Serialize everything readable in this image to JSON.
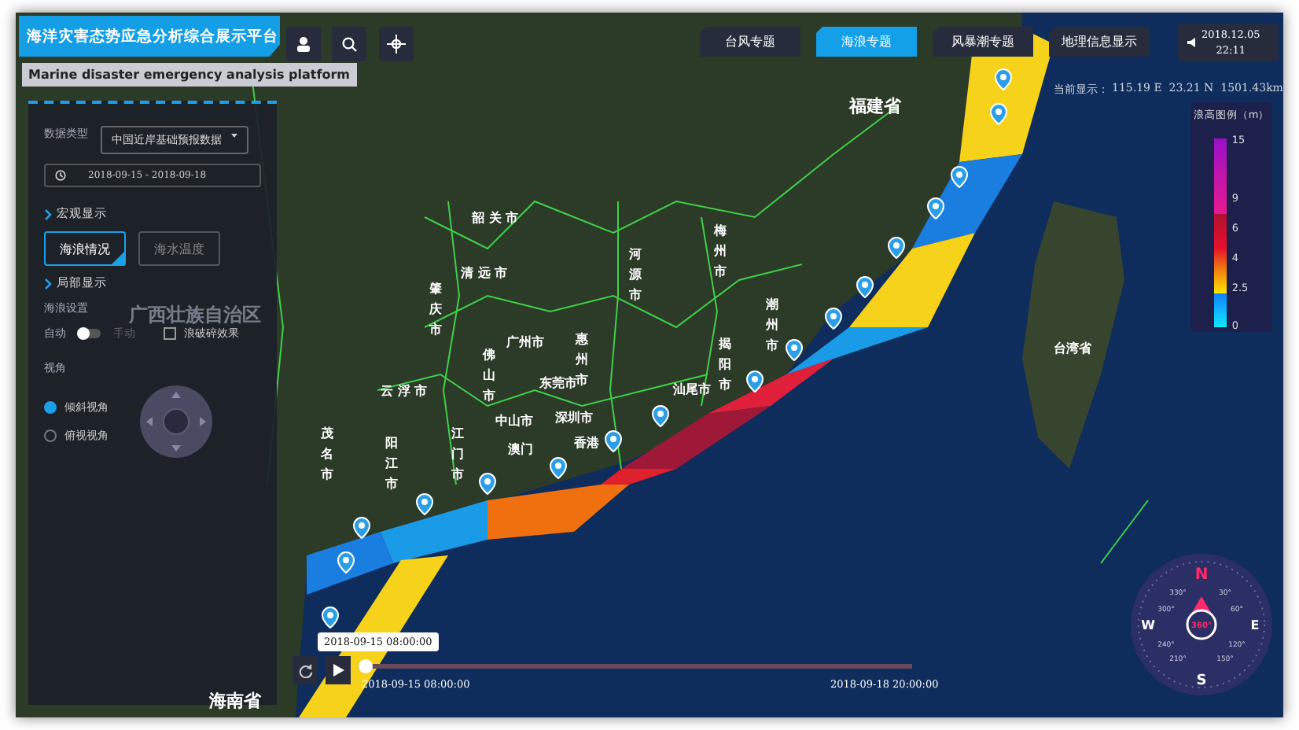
{
  "header": {
    "title": "海洋灾害态势应急分析综合展示平台",
    "subtitle": "Marine disaster emergency analysis platform"
  },
  "tabs": [
    {
      "label": "台风专题",
      "selected": false
    },
    {
      "label": "海浪专题",
      "selected": true
    },
    {
      "label": "风暴潮专题",
      "selected": false
    },
    {
      "label": "地理信息显示",
      "selected": false
    }
  ],
  "clock": {
    "date": "2018.12.05",
    "time": "22:11"
  },
  "coordinates": {
    "label": "当前显示：",
    "value": "115.19 E  23.21 N  1501.43km"
  },
  "panel": {
    "data_type_label": "数据类型",
    "data_type_value": "中国近岸基础预报数据",
    "date_range": "2018-09-15 - 2018-09-18",
    "macro_heading": "宏观显示",
    "macro_buttons": [
      {
        "label": "海浪情况",
        "selected": true
      },
      {
        "label": "海水温度",
        "selected": false
      }
    ],
    "local_heading": "局部显示",
    "wave_settings_label": "海浪设置",
    "mode_toggle": {
      "left_label": "自动",
      "right_label": "手动",
      "on": false
    },
    "breaking_checkbox": {
      "label": "浪破碎效果",
      "checked": false
    },
    "view_heading": "视角",
    "view_options": [
      {
        "label": "倾斜视角",
        "selected": true
      },
      {
        "label": "俯视视角",
        "selected": false
      }
    ]
  },
  "map_labels": [
    {
      "text": "福建省",
      "kind": "province"
    },
    {
      "text": "台湾省",
      "kind": "city"
    },
    {
      "text": "广西壮族自治区",
      "kind": "faded"
    },
    {
      "text": "海南省",
      "kind": "province"
    },
    {
      "text": "韶 关 市",
      "kind": "city"
    },
    {
      "text": "清 远 市",
      "kind": "city"
    },
    {
      "text": "河源市",
      "kind": "vertical"
    },
    {
      "text": "梅州市",
      "kind": "vertical"
    },
    {
      "text": "肇庆市",
      "kind": "vertical"
    },
    {
      "text": "广州市",
      "kind": "city"
    },
    {
      "text": "惠州市",
      "kind": "vertical"
    },
    {
      "text": "云 浮 市",
      "kind": "city"
    },
    {
      "text": "佛山市",
      "kind": "vertical"
    },
    {
      "text": "东莞市",
      "kind": "city"
    },
    {
      "text": "揭阳市",
      "kind": "vertical"
    },
    {
      "text": "潮州市",
      "kind": "vertical"
    },
    {
      "text": "汕尾市",
      "kind": "city"
    },
    {
      "text": "深圳市",
      "kind": "city"
    },
    {
      "text": "中山市",
      "kind": "city"
    },
    {
      "text": "江门市",
      "kind": "vertical"
    },
    {
      "text": "阳江市",
      "kind": "vertical"
    },
    {
      "text": "茂名市",
      "kind": "vertical"
    },
    {
      "text": "香港",
      "kind": "city"
    },
    {
      "text": "澳门",
      "kind": "city"
    }
  ],
  "legend": {
    "title": "浪高图例（m）",
    "ticks": [
      "15",
      "9",
      "6",
      "4",
      "2.5",
      "0"
    ]
  },
  "timeline": {
    "tooltip": "2018-09-15 08:00:00",
    "start": "2018-09-15 08:00:00",
    "end": "2018-09-18 20:00:00",
    "level": 0
  },
  "compass": {
    "north": "N",
    "south": "S",
    "east": "E",
    "west": "W",
    "heading": "360°",
    "degrees": [
      "30°",
      "60°",
      "120°",
      "150°",
      "210°",
      "240°",
      "300°",
      "330°"
    ]
  }
}
